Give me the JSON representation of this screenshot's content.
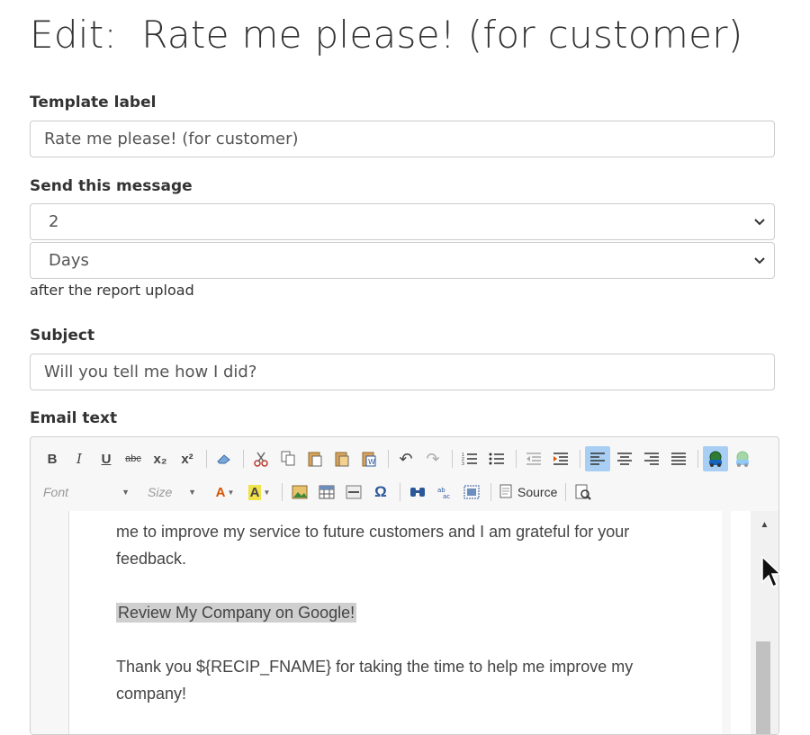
{
  "page": {
    "title": "Edit:  Rate me please! (for customer)"
  },
  "form": {
    "template_label": {
      "label": "Template label",
      "value": "Rate me please! (for customer)"
    },
    "send": {
      "label": "Send this message",
      "amount": "2",
      "unit": "Days",
      "helper": "after the report upload"
    },
    "subject": {
      "label": "Subject",
      "value": "Will you tell me how I did?"
    },
    "email_text": {
      "label": "Email text"
    }
  },
  "editor": {
    "toolbar": {
      "font_combo": "Font",
      "size_combo": "Size",
      "source_label": "Source",
      "icons": {
        "bold": "B",
        "italic": "I",
        "underline": "U",
        "strike": "abc",
        "subscript": "x₂",
        "superscript": "x²",
        "undo": "↶",
        "redo": "↷",
        "special_char": "Ω",
        "text_color": "A",
        "bg_color": "A"
      }
    },
    "content": {
      "para1": "me to improve my service to future customers and I am grateful for your feedback.",
      "link": "Review My Company on Google!",
      "para2": "Thank you ${RECIP_FNAME} for taking the time to help me improve my company!"
    }
  }
}
